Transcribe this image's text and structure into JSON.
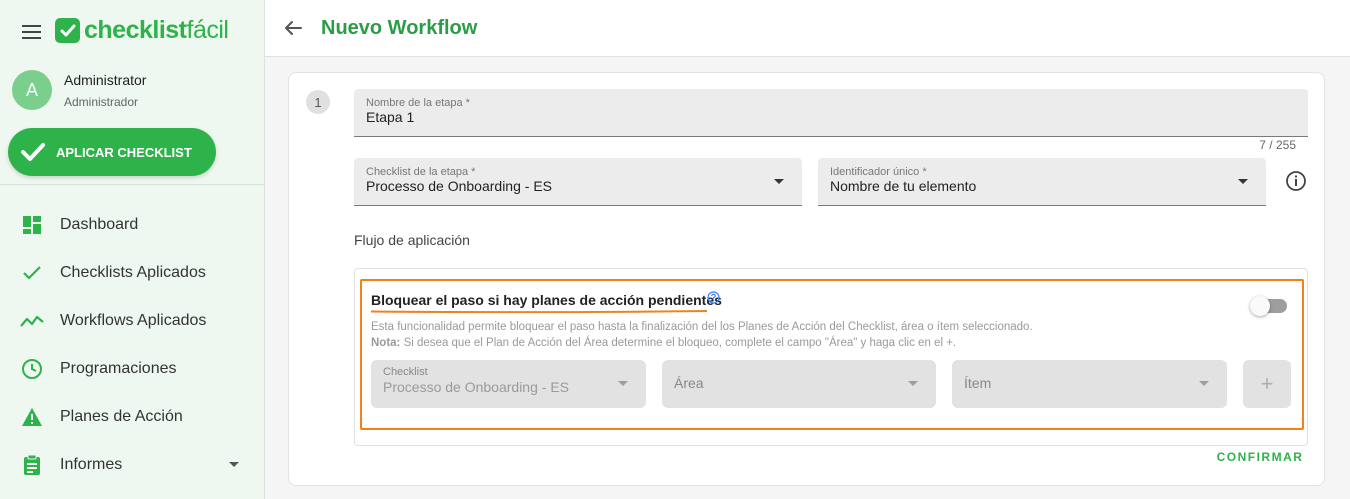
{
  "brand": {
    "name_bold": "checklist",
    "name_light": "fácil",
    "color": "#2db34a"
  },
  "user": {
    "initial": "A",
    "name": "Administrator",
    "role": "Administrador"
  },
  "sidebar": {
    "apply_button": "APLICAR CHECKLIST",
    "items": [
      {
        "label": "Dashboard",
        "icon": "dashboard-icon"
      },
      {
        "label": "Checklists Aplicados",
        "icon": "check-icon"
      },
      {
        "label": "Workflows Aplicados",
        "icon": "trending-icon"
      },
      {
        "label": "Programaciones",
        "icon": "clock-icon"
      },
      {
        "label": "Planes de Acción",
        "icon": "warning-icon"
      },
      {
        "label": "Informes",
        "icon": "clipboard-icon"
      }
    ]
  },
  "header": {
    "title": "Nuevo Workflow"
  },
  "stage": {
    "number": "1",
    "name_label": "Nombre de la etapa *",
    "name_value": "Etapa 1",
    "char_counter": "7 / 255",
    "checklist_label": "Checklist de la etapa *",
    "checklist_value": "Processo de Onboarding - ES",
    "identifier_label": "Identificador único *",
    "identifier_value": "Nombre de tu elemento",
    "flow_title": "Flujo de aplicación"
  },
  "block": {
    "title": "Bloquear el paso si hay planes de acción pendientes",
    "toggle_on": false,
    "description": "Esta funcionalidad permite bloquear el paso hasta la finalización del los Planes de Acción del Checklist, área o ítem seleccionado.",
    "note_label": "Nota:",
    "note_text": " Si desea que el Plan de Acción del Área determine el bloqueo, complete el campo \"Área\" y haga clic en el +.",
    "checklist_label": "Checklist",
    "checklist_value": "Processo de Onboarding - ES",
    "area_placeholder": "Área",
    "item_placeholder": "Ítem",
    "add_label": "+"
  },
  "actions": {
    "confirm": "CONFIRMAR"
  },
  "colors": {
    "accent": "#2db34a",
    "title_green": "#2a9d47",
    "highlight": "#f0821e"
  }
}
